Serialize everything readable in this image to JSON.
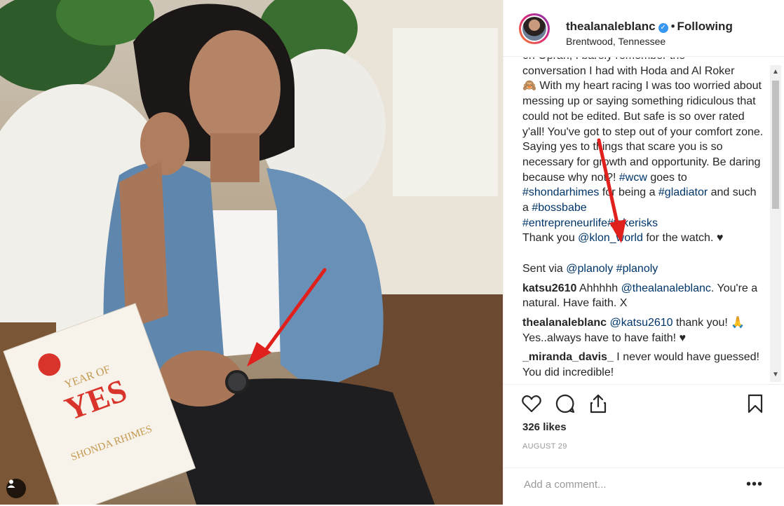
{
  "post": {
    "username": "thealanaleblanc",
    "follow_status": "Following",
    "separator": "•",
    "location": "Brentwood, Tennessee"
  },
  "caption": {
    "clipped_top": "on Oprah, I barely remember the",
    "l1": "conversation I had with Hoda and Al Roker",
    "l2": "🙈 With my heart racing I was too worried about messing up or saying something ridiculous that could not be edited. But safe is so over rated y'all! You've got to step out of your comfort zone. Saying yes to things that scare you is so necessary for growth and opportunity. Be daring because why not?! ",
    "tag_wcw": "#wcw",
    "goes_to": " goes to ",
    "tag_shonda": "#shondarhimes",
    "for_being": " for being a ",
    "tag_gladiator": "#gladiator",
    "and_such": " and such a ",
    "tag_bossbabe": "#bossbabe",
    "tag_entrepreneur": "#entrepreneurlife",
    "tag_takerisks": "#takerisks",
    "thank_you": "Thank you ",
    "mention_klon": "@klon_world",
    "for_watch": " for the watch. ♥",
    "sent_via": "Sent via ",
    "mention_planoly": "@planoly",
    "tag_planoly": "#planoly"
  },
  "comments": [
    {
      "user": "katsu2610",
      "mention": "@thealanaleblanc",
      "text": ". You're a natural. Have faith. X",
      "pre": " Ahhhhh "
    },
    {
      "user": "thealanaleblanc",
      "mention": "@katsu2610",
      "text": " thank you! 🙏 Yes..always have to have faith! ♥",
      "pre": " "
    },
    {
      "user": "_miranda_davis_",
      "text": " I never would have guessed! You did incredible!"
    }
  ],
  "actions": {
    "likes": "326 likes",
    "date": "AUGUST 29",
    "comment_placeholder": "Add a comment...",
    "more": "•••"
  },
  "photo": {
    "book_title": "YEAR OF YES",
    "book_author": "SHONDA RHIMES"
  },
  "colors": {
    "link": "#003569",
    "verified": "#3897f0",
    "arrow": "#e0201c"
  }
}
